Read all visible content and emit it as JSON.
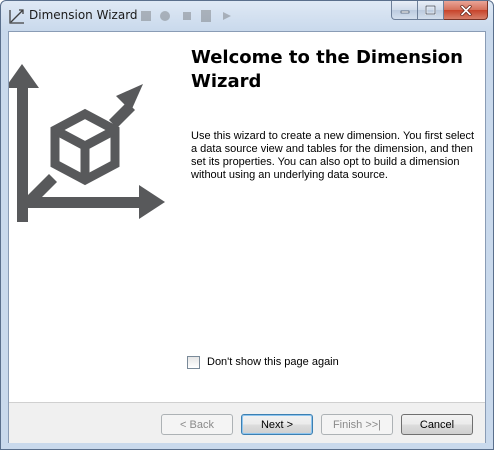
{
  "window": {
    "title": "Dimension Wizard",
    "icon": "wizard-icon"
  },
  "controls": {
    "minimize_icon": "minimize-icon",
    "maximize_icon": "maximize-icon",
    "close_icon": "close-icon"
  },
  "content": {
    "heading": "Welcome to the Dimension Wizard",
    "description": "Use this wizard to create a new dimension. You first select a data source view and tables for the dimension, and then set its properties. You can also opt to build a dimension without using an underlying data source.",
    "graphic_icon": "cube-axes-icon",
    "dont_show_label": "Don't show this page again",
    "dont_show_checked": false
  },
  "buttons": {
    "back": "< Back",
    "next": "Next >",
    "finish": "Finish >>|",
    "cancel": "Cancel"
  },
  "colors": {
    "graphic": "#58595b",
    "accent": "#3c7fb1"
  }
}
